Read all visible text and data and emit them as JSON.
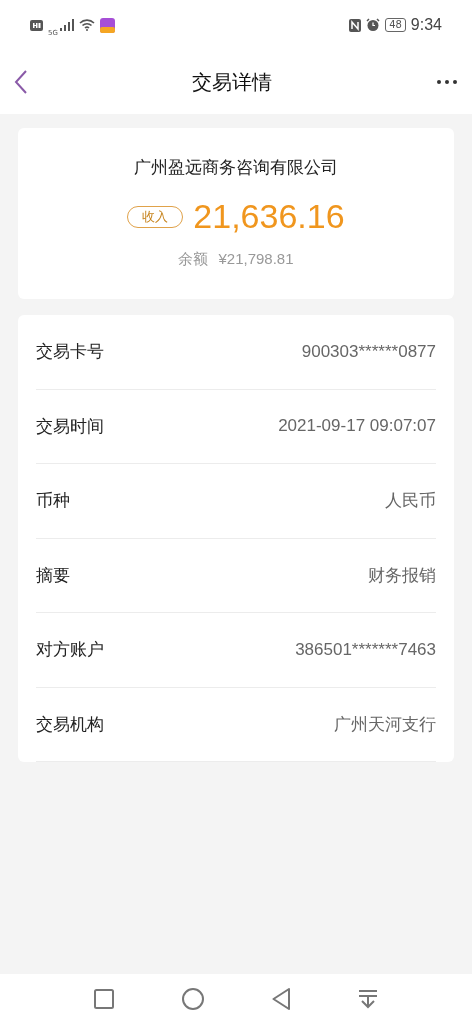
{
  "status_bar": {
    "network": "5G",
    "battery": "48",
    "time": "9:34"
  },
  "header": {
    "title": "交易详情"
  },
  "summary": {
    "counterparty": "广州盈远商务咨询有限公司",
    "type_tag": "收入",
    "amount": "21,636.16",
    "balance_label": "余额",
    "balance": "¥21,798.81"
  },
  "details": [
    {
      "label": "交易卡号",
      "value": "900303******0877"
    },
    {
      "label": "交易时间",
      "value": "2021-09-17 09:07:07"
    },
    {
      "label": "币种",
      "value": "人民币"
    },
    {
      "label": "摘要",
      "value": "财务报销"
    },
    {
      "label": "对方账户",
      "value": "386501*******7463"
    },
    {
      "label": "交易机构",
      "value": "广州天河支行"
    }
  ]
}
